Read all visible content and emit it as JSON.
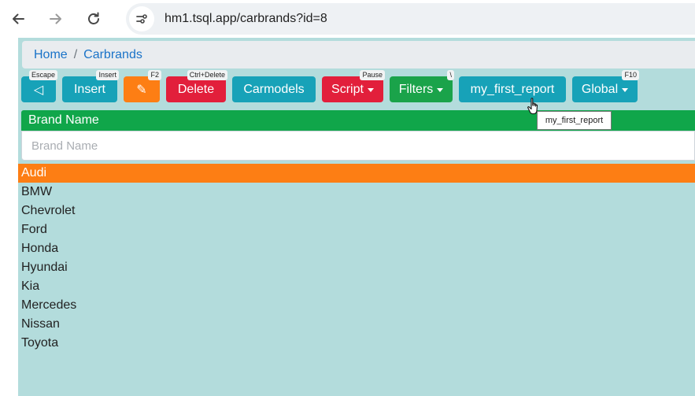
{
  "browser": {
    "url": "hm1.tsql.app/carbrands?id=8"
  },
  "breadcrumb": {
    "home": "Home",
    "separator": "/",
    "current": "Carbrands"
  },
  "toolbar": {
    "back": {
      "label": "◁",
      "shortcut": "Escape"
    },
    "insert": {
      "label": "Insert",
      "shortcut": "Insert"
    },
    "edit": {
      "label": "✎",
      "shortcut": "F2"
    },
    "delete": {
      "label": "Delete",
      "shortcut": "Ctrl+Delete"
    },
    "carmodels": {
      "label": "Carmodels"
    },
    "script": {
      "label": "Script",
      "shortcut": "Pause"
    },
    "filters": {
      "label": "Filters",
      "shortcut": "\\"
    },
    "report": {
      "label": "my_first_report",
      "tooltip": "my_first_report"
    },
    "global": {
      "label": "Global",
      "shortcut": "F10"
    }
  },
  "table": {
    "column_header": "Brand Name",
    "filter_placeholder": "Brand Name",
    "rows": [
      "Audi",
      "BMW",
      "Chevrolet",
      "Ford",
      "Honda",
      "Hyundai",
      "Kia",
      "Mercedes",
      "Nissan",
      "Toyota"
    ],
    "selected_row": "Audi"
  },
  "colors": {
    "teal": "#17a2b8",
    "orange": "#fd7e14",
    "red": "#e21f3b",
    "green": "#1aa34a",
    "background": "#b3dcdc"
  }
}
